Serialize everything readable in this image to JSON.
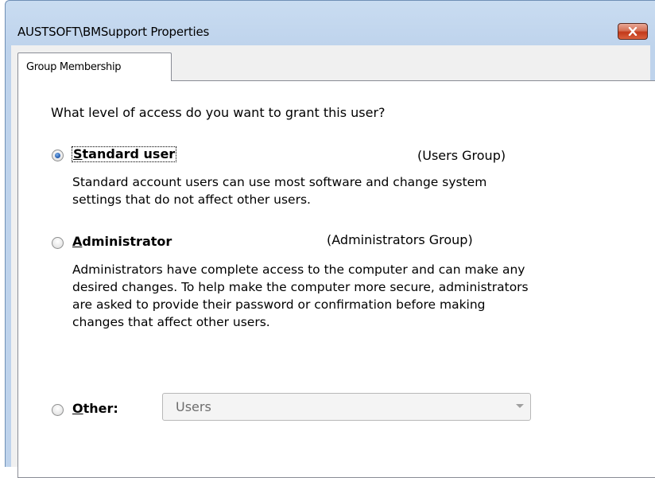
{
  "window": {
    "title": "AUSTSOFT\\BMSupport Properties",
    "close_icon": "close-x-icon"
  },
  "tabs": [
    {
      "label": "Group Membership",
      "selected": true
    }
  ],
  "prompt": "What level of access do you want to grant this user?",
  "options": {
    "standard": {
      "label_mnemonic": "S",
      "label_rest": "tandard user",
      "group": "(Users Group)",
      "description": "Standard account users can use most software and change system settings that do not affect other users.",
      "checked": true
    },
    "administrator": {
      "label_mnemonic": "A",
      "label_rest": "dministrator",
      "group": "(Administrators Group)",
      "description": "Administrators have complete access to the computer and can make any desired changes. To help make the computer more secure, administrators are asked to provide their password or confirmation before making changes that affect other users.",
      "checked": false
    },
    "other": {
      "label_mnemonic": "O",
      "label_rest": "ther:",
      "checked": false,
      "select_value": "Users",
      "select_enabled": false
    }
  },
  "colors": {
    "frame": "#bed3ec",
    "close_button": "#c2391a",
    "radio_dot": "#2a62b5"
  }
}
